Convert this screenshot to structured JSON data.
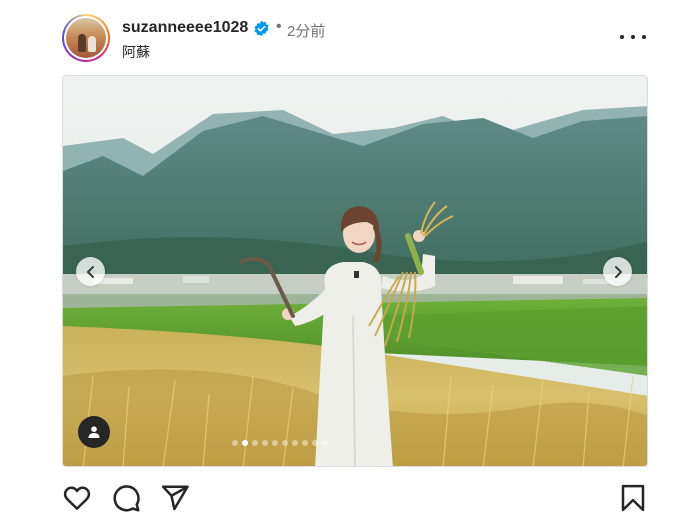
{
  "post": {
    "username": "suzanneeee1028",
    "separator": "•",
    "time_ago": "2分前",
    "location": "阿蘇",
    "verified": true,
    "colors": {
      "verified_blue": "#0095f6",
      "ring_start": "#feda75",
      "ring_end": "#4f5bd5"
    }
  },
  "media": {
    "description_icons": [
      "chevron-left-icon",
      "chevron-right-icon",
      "person-tag-icon"
    ],
    "carousel": {
      "total_slides": 10,
      "active_index": 1
    }
  },
  "actions": {
    "icons": [
      "heart-icon",
      "comment-icon",
      "share-icon",
      "bookmark-icon"
    ]
  }
}
